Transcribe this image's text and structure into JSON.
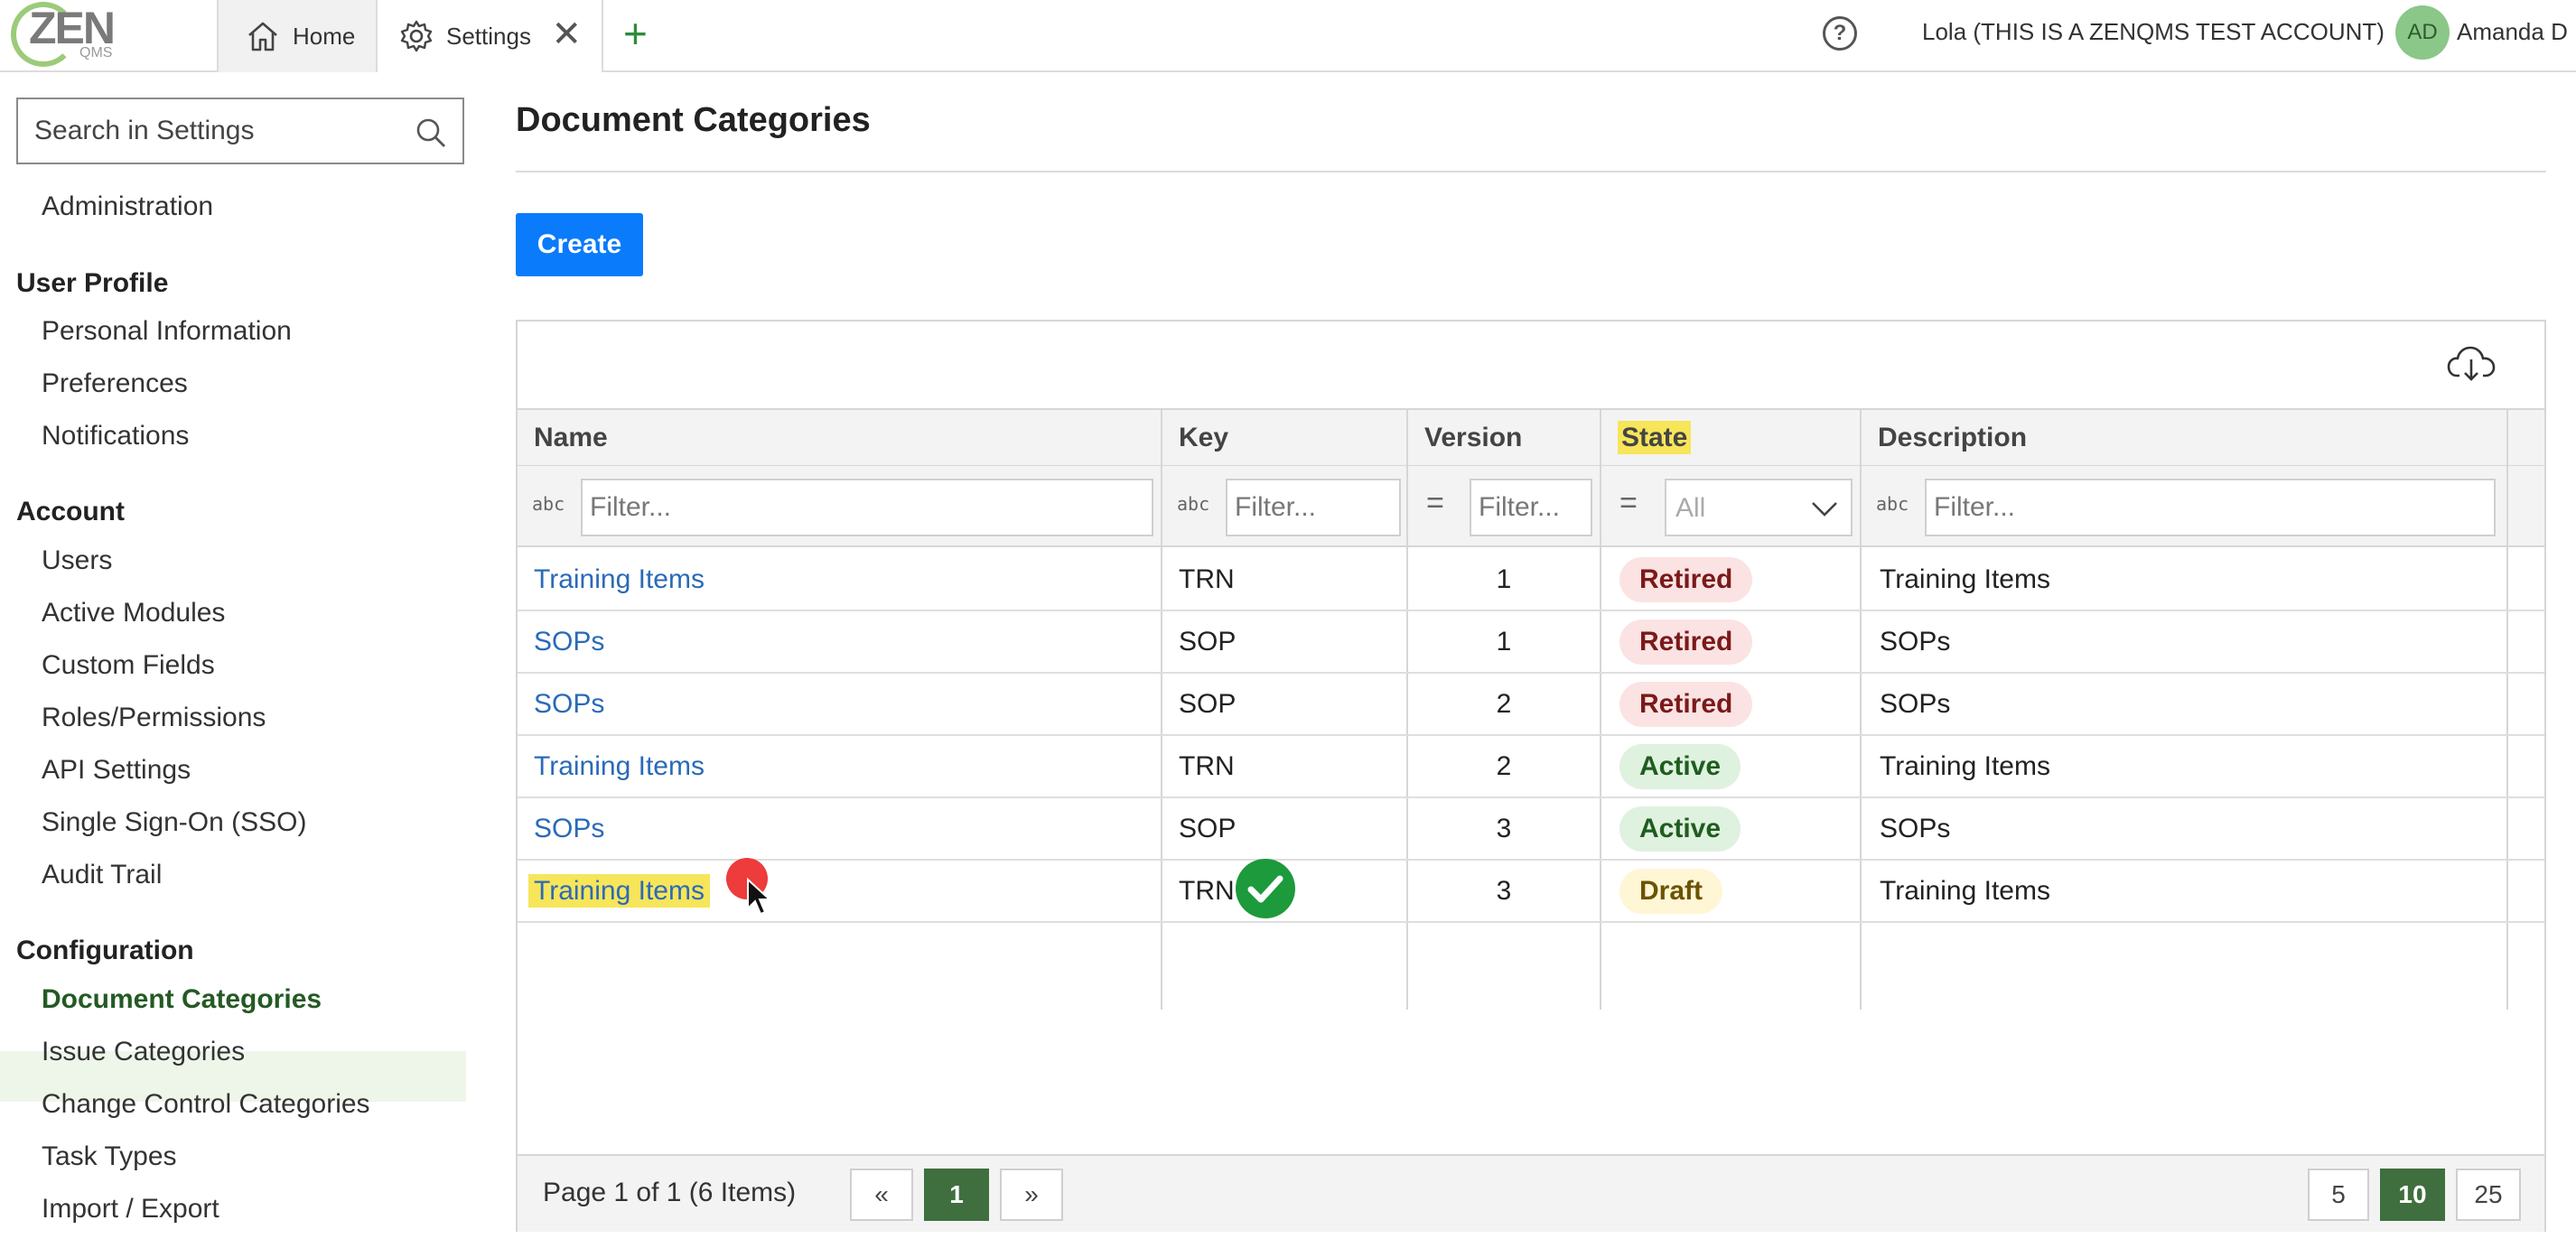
{
  "app": {
    "logo_text": "ZEN",
    "logo_sub": "QMS"
  },
  "tabs": [
    {
      "label": "Home",
      "icon": "home-icon"
    },
    {
      "label": "Settings",
      "icon": "gear-icon"
    }
  ],
  "header": {
    "help_glyph": "?",
    "account_label": "Lola (THIS IS A ZENQMS TEST ACCOUNT)",
    "avatar_initials": "AD",
    "user_name": "Amanda D"
  },
  "sidebar": {
    "search_placeholder": "Search in Settings",
    "admin_item": "Administration",
    "groups": {
      "user_profile": "User Profile",
      "account": "Account",
      "configuration": "Configuration"
    },
    "user_profile_items": [
      "Personal Information",
      "Preferences",
      "Notifications"
    ],
    "account_items": [
      "Users",
      "Active Modules",
      "Custom Fields",
      "Roles/Permissions",
      "API Settings",
      "Single Sign-On (SSO)",
      "Audit Trail"
    ],
    "configuration_items": [
      "Document Categories",
      "Issue Categories",
      "Change Control Categories",
      "Task Types",
      "Import / Export"
    ],
    "active_item": "Document Categories"
  },
  "main": {
    "title": "Document Categories",
    "create_label": "Create"
  },
  "grid": {
    "columns": [
      "Name",
      "Key",
      "Version",
      "State",
      "Description"
    ],
    "filter_placeholder": "Filter...",
    "state_filter_value": "All",
    "rows": [
      {
        "name": "Training Items",
        "key": "TRN",
        "version": "1",
        "state": "Retired",
        "description": "Training Items"
      },
      {
        "name": "SOPs",
        "key": "SOP",
        "version": "1",
        "state": "Retired",
        "description": "SOPs"
      },
      {
        "name": "SOPs",
        "key": "SOP",
        "version": "2",
        "state": "Retired",
        "description": "SOPs"
      },
      {
        "name": "Training Items",
        "key": "TRN",
        "version": "2",
        "state": "Active",
        "description": "Training Items"
      },
      {
        "name": "SOPs",
        "key": "SOP",
        "version": "3",
        "state": "Active",
        "description": "SOPs"
      },
      {
        "name": "Training Items",
        "key": "TRN",
        "version": "3",
        "state": "Draft",
        "description": "Training Items"
      }
    ]
  },
  "pager": {
    "info": "Page 1 of 1 (6 Items)",
    "prev": "«",
    "current": "1",
    "next": "»",
    "sizes": [
      "5",
      "10",
      "25"
    ],
    "active_size": "10"
  },
  "colors": {
    "accent": "#0a7bfb",
    "link": "#2a6ab8",
    "highlight": "#f7e55a",
    "active_page": "#3f6f3f"
  }
}
